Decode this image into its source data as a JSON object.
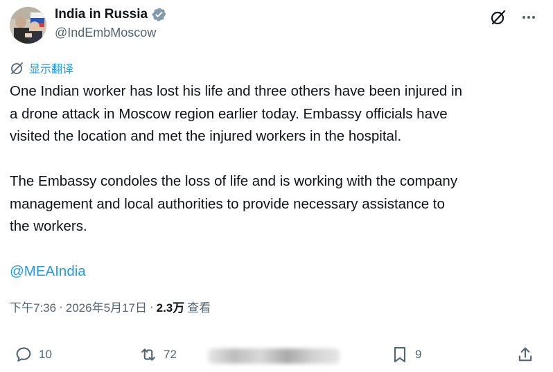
{
  "header": {
    "display_name": "India in Russia",
    "handle": "@IndEmbMoscow",
    "verified": true
  },
  "translate": {
    "label": "显示翻译"
  },
  "tweet": {
    "paragraph1": "One Indian worker has lost his life and three others have been injured in\na drone attack in Moscow region earlier today. Embassy officials have\nvisited the location and met the injured workers in the hospital.",
    "paragraph2": "The Embassy condoles the loss of life and is working with the company\nmanagement and local authorities to provide necessary assistance to\nthe workers.",
    "mention": "@MEAIndia"
  },
  "meta": {
    "time": "下午7:36",
    "sep1": "·",
    "date": "2026年5月17日",
    "sep2": "·",
    "views": "2.3万",
    "views_label": "查看"
  },
  "actions": {
    "replies": "10",
    "reposts": "72",
    "bookmarks": "9"
  },
  "colors": {
    "accent": "#1d9bf0",
    "secondary_text": "#536471",
    "primary_text": "#0f1419"
  }
}
